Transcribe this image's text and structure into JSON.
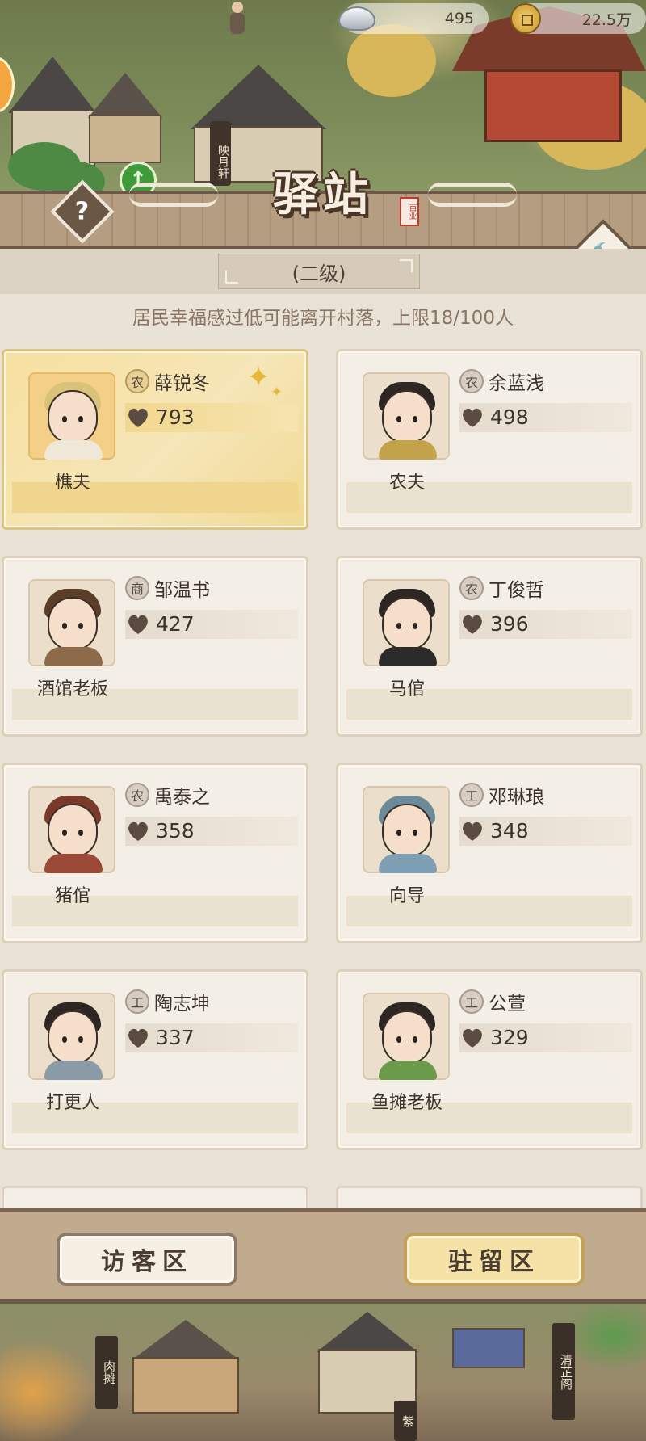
{
  "currency": {
    "silver": "495",
    "coins": "22.5万"
  },
  "scene_signs": {
    "top": "映月轩",
    "meat_stall": "肉摊",
    "qingzhi": "清芷阁",
    "zi": "紫"
  },
  "header": {
    "title": "驿站",
    "seal": "百业",
    "help": "?",
    "level": "(二级)",
    "notice": "居民幸福感过低可能离开村落，上限18/100人"
  },
  "residents": [
    {
      "name": "薛锐冬",
      "role": "樵夫",
      "category": "农",
      "score": "793"
    },
    {
      "name": "余蓝浅",
      "role": "农夫",
      "category": "农",
      "score": "498"
    },
    {
      "name": "邹温书",
      "role": "酒馆老板",
      "category": "商",
      "score": "427"
    },
    {
      "name": "丁俊哲",
      "role": "马倌",
      "category": "农",
      "score": "396"
    },
    {
      "name": "禹泰之",
      "role": "猪倌",
      "category": "农",
      "score": "358"
    },
    {
      "name": "邓琳琅",
      "role": "向导",
      "category": "工",
      "score": "348"
    },
    {
      "name": "陶志坤",
      "role": "打更人",
      "category": "工",
      "score": "337"
    },
    {
      "name": "公萱",
      "role": "鱼摊老板",
      "category": "工",
      "score": "329"
    }
  ],
  "tabs": {
    "visitor": "访客区",
    "resident": "驻留区"
  },
  "colors": {
    "accent_gold": "#f6e2a6",
    "card_bg": "#f4efe6",
    "header_wood": "#b59d81"
  },
  "icons": {
    "silver": "silver-ingot-icon",
    "coin": "copper-coin-icon",
    "help": "question-icon",
    "build": "hammer-icon",
    "happiness": "heart-icon",
    "sparkle": "sparkle-icon"
  }
}
